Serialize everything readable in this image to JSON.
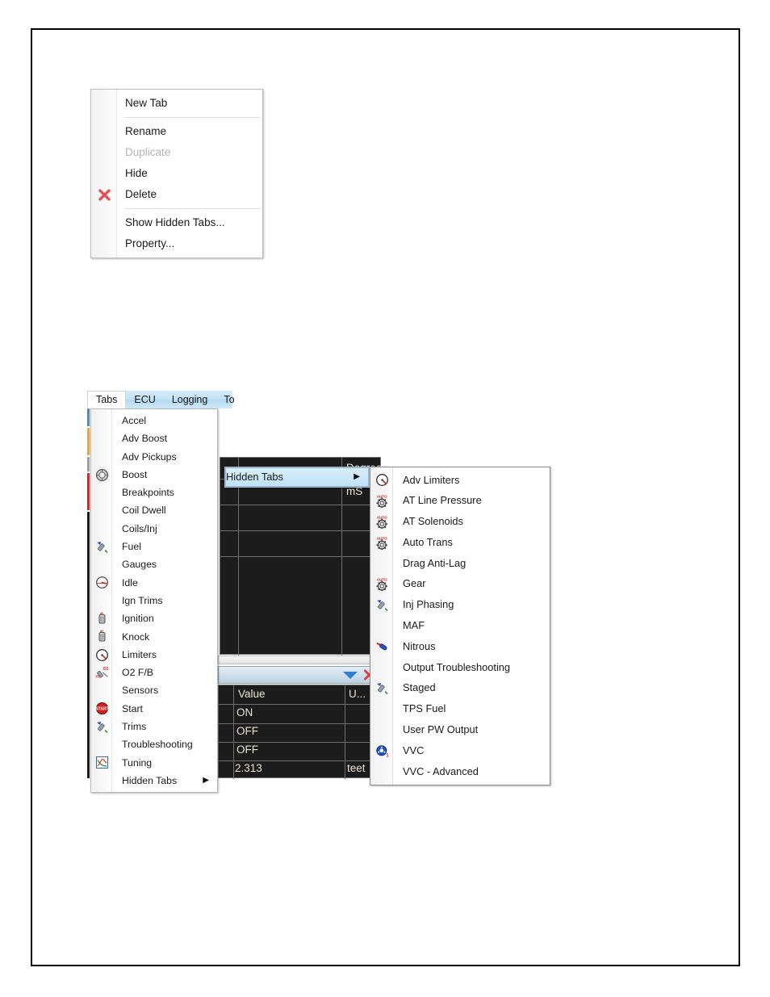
{
  "tab_context_menu": {
    "name": "tab-context-menu",
    "items": [
      {
        "label": "New Tab",
        "icon": "",
        "disabled": false,
        "separator_after": true
      },
      {
        "label": "Rename",
        "icon": "",
        "disabled": false,
        "separator_after": false
      },
      {
        "label": "Duplicate",
        "icon": "",
        "disabled": true,
        "separator_after": false
      },
      {
        "label": "Hide",
        "icon": "",
        "disabled": false,
        "separator_after": false
      },
      {
        "label": "Delete",
        "icon": "red-x-icon",
        "disabled": false,
        "separator_after": true
      },
      {
        "label": "Show Hidden Tabs...",
        "icon": "",
        "disabled": false,
        "separator_after": false
      },
      {
        "label": "Property...",
        "icon": "",
        "disabled": false,
        "separator_after": false
      }
    ]
  },
  "menubar": {
    "name": "application-menu-bar",
    "items": [
      {
        "label": "Tabs",
        "active": true
      },
      {
        "label": "ECU",
        "active": false
      },
      {
        "label": "Logging",
        "active": false
      },
      {
        "label": "To",
        "active": false
      }
    ]
  },
  "tabs_menu": {
    "name": "tabs-dropdown-menu",
    "items": [
      {
        "label": "Accel",
        "icon": "",
        "submenu": false
      },
      {
        "label": "Adv Boost",
        "icon": "",
        "submenu": false
      },
      {
        "label": "Adv Pickups",
        "icon": "",
        "submenu": false
      },
      {
        "label": "Boost",
        "icon": "turbo-icon",
        "submenu": false
      },
      {
        "label": "Breakpoints",
        "icon": "",
        "submenu": false
      },
      {
        "label": "Coil Dwell",
        "icon": "",
        "submenu": false
      },
      {
        "label": "Coils/Inj",
        "icon": "",
        "submenu": false
      },
      {
        "label": "Fuel",
        "icon": "injector-icon",
        "submenu": false
      },
      {
        "label": "Gauges",
        "icon": "",
        "submenu": false
      },
      {
        "label": "Idle",
        "icon": "gauge-icon",
        "submenu": false
      },
      {
        "label": "Ign Trims",
        "icon": "",
        "submenu": false
      },
      {
        "label": "Ignition",
        "icon": "coil-icon",
        "submenu": false
      },
      {
        "label": "Knock",
        "icon": "coil-icon",
        "submenu": false
      },
      {
        "label": "Limiters",
        "icon": "limiter-icon",
        "submenu": false
      },
      {
        "label": "O2 F/B",
        "icon": "o2-sensor-icon",
        "submenu": false
      },
      {
        "label": "Sensors",
        "icon": "",
        "submenu": false
      },
      {
        "label": "Start",
        "icon": "start-icon",
        "submenu": false
      },
      {
        "label": "Trims",
        "icon": "injector-icon",
        "submenu": false
      },
      {
        "label": "Troubleshooting",
        "icon": "",
        "submenu": false
      },
      {
        "label": "Tuning",
        "icon": "chart-icon",
        "submenu": false
      },
      {
        "label": "Hidden Tabs",
        "icon": "",
        "submenu": true
      }
    ],
    "submenu_arrow": "▶"
  },
  "hidden_tabs_parent": {
    "name": "hidden-tabs-parent-item",
    "label": "Hidden Tabs",
    "arrow": "▶",
    "highlighted": true
  },
  "hidden_tabs_menu": {
    "name": "hidden-tabs-submenu",
    "items": [
      {
        "label": "Adv Limiters",
        "icon": "limiter-icon"
      },
      {
        "label": "AT Line Pressure",
        "icon": "auto-gear-icon"
      },
      {
        "label": "AT Solenoids",
        "icon": "auto-gear-icon"
      },
      {
        "label": "Auto Trans",
        "icon": "auto-gear-icon"
      },
      {
        "label": "Drag Anti-Lag",
        "icon": ""
      },
      {
        "label": "Gear",
        "icon": "auto-gear-icon"
      },
      {
        "label": "Inj Phasing",
        "icon": "injector-icon"
      },
      {
        "label": "MAF",
        "icon": ""
      },
      {
        "label": "Nitrous",
        "icon": "nitrous-icon"
      },
      {
        "label": "Output Troubleshooting",
        "icon": ""
      },
      {
        "label": "Staged",
        "icon": "injector-icon"
      },
      {
        "label": "TPS Fuel",
        "icon": ""
      },
      {
        "label": "User PW Output",
        "icon": ""
      },
      {
        "label": "VVC",
        "icon": "vvc-icon"
      },
      {
        "label": "VVC - Advanced",
        "icon": ""
      }
    ]
  },
  "background_grid": {
    "name": "data-grid",
    "unit_cells": [
      "Degrees",
      "mS"
    ],
    "columns": [
      "Value",
      "U..."
    ],
    "rows": [
      {
        "value": "ON",
        "unit": ""
      },
      {
        "value": "OFF",
        "unit": ""
      },
      {
        "value": "OFF",
        "unit": ""
      },
      {
        "value": "2.313",
        "unit": "teet"
      }
    ]
  },
  "panel_toolbar": {
    "name": "panel-toolbar",
    "dropdown_icon": "chevron-down-icon",
    "close_icon": "close-x-icon"
  },
  "colors": {
    "menu_background": "#ffffff",
    "menu_border": "#b9b9b9",
    "highlight_fill": "#bfe2f7",
    "highlight_border": "#7eb4ea",
    "disabled_text": "#b4b4b4",
    "grid_background": "#1c1c1c",
    "grid_text": "#e8e2d2",
    "menubar_blue": "#c2e2f6",
    "delete_red": "#e23b3b"
  }
}
